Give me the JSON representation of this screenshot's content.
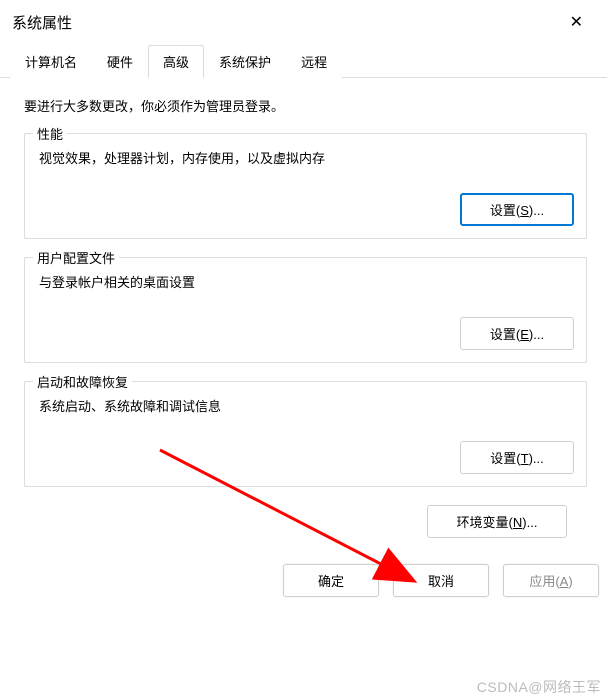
{
  "title": "系统属性",
  "close_glyph": "✕",
  "tabs": {
    "computer_name": "计算机名",
    "hardware": "硬件",
    "advanced": "高级",
    "system_protection": "系统保护",
    "remote": "远程"
  },
  "intro": "要进行大多数更改，你必须作为管理员登录。",
  "performance": {
    "title": "性能",
    "desc": "视觉效果，处理器计划，内存使用，以及虚拟内存",
    "button_pre": "设置(",
    "button_key": "S",
    "button_post": ")..."
  },
  "user_profiles": {
    "title": "用户配置文件",
    "desc": "与登录帐户相关的桌面设置",
    "button_pre": "设置(",
    "button_key": "E",
    "button_post": ")..."
  },
  "startup": {
    "title": "启动和故障恢复",
    "desc": "系统启动、系统故障和调试信息",
    "button_pre": "设置(",
    "button_key": "T",
    "button_post": ")..."
  },
  "env_button": {
    "pre": "环境变量(",
    "key": "N",
    "post": ")..."
  },
  "bottom": {
    "ok": "确定",
    "cancel": "取消",
    "apply_pre": "应用(",
    "apply_key": "A",
    "apply_post": ")"
  },
  "watermark": "CSDNA@网络王军"
}
